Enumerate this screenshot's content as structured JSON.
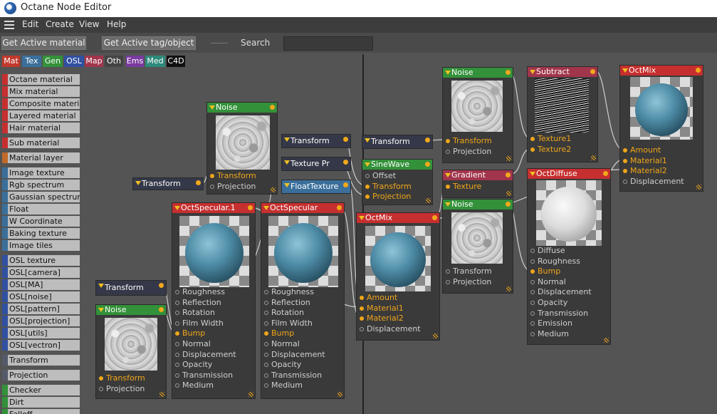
{
  "window": {
    "title": "Octane Node Editor"
  },
  "menu": {
    "items": [
      "Edit",
      "Create",
      "View",
      "Help"
    ]
  },
  "toolbar": {
    "get_active_material": "Get Active material",
    "get_active_tag": "Get Active tag/object",
    "search_label": "Search",
    "search_value": ""
  },
  "categories": [
    {
      "label": "Mat",
      "color": "#c0392b"
    },
    {
      "label": "Tex",
      "color": "#3b6f9b"
    },
    {
      "label": "Gen",
      "color": "#33913a"
    },
    {
      "label": "OSL",
      "color": "#3050a0"
    },
    {
      "label": "Map",
      "color": "#a1354c"
    },
    {
      "label": "Oth",
      "color": "#444444"
    },
    {
      "label": "Ems",
      "color": "#7a3aa0"
    },
    {
      "label": "Med",
      "color": "#2e8a7a"
    },
    {
      "label": "C4D",
      "color": "#111111"
    }
  ],
  "sidebar": {
    "items": [
      {
        "label": "Octane material",
        "color": "#c62f2f"
      },
      {
        "label": "Mix material",
        "color": "#c62f2f"
      },
      {
        "label": "Composite material",
        "color": "#c62f2f"
      },
      {
        "label": "Layered material",
        "color": "#c62f2f"
      },
      {
        "label": "Hair material",
        "color": "#c62f2f"
      },
      {
        "label": "Sub material",
        "color": "#c62f2f"
      },
      {
        "label": "Material layer",
        "color": "#c06a2a"
      },
      {
        "label": "Image texture",
        "color": "#3b6f9b"
      },
      {
        "label": "Rgb spectrum",
        "color": "#3b6f9b"
      },
      {
        "label": "Gaussian spectrum",
        "color": "#3b6f9b"
      },
      {
        "label": "Float",
        "color": "#3b6f9b"
      },
      {
        "label": "W Coordinate",
        "color": "#3b6f9b"
      },
      {
        "label": "Baking texture",
        "color": "#3b6f9b"
      },
      {
        "label": "Image tiles",
        "color": "#3b6f9b"
      },
      {
        "label": "OSL texture",
        "color": "#3050a0"
      },
      {
        "label": "OSL[camera]",
        "color": "#3050a0"
      },
      {
        "label": "OSL[MA]",
        "color": "#3050a0"
      },
      {
        "label": "OSL[noise]",
        "color": "#3050a0"
      },
      {
        "label": "OSL[pattern]",
        "color": "#3050a0"
      },
      {
        "label": "OSL[projection]",
        "color": "#3050a0"
      },
      {
        "label": "OSL[utils]",
        "color": "#3050a0"
      },
      {
        "label": "OSL[vectron]",
        "color": "#3050a0"
      },
      {
        "label": "Transform",
        "color": "#555a6a"
      },
      {
        "label": "Projection",
        "color": "#555a6a"
      },
      {
        "label": "Checker",
        "color": "#33913a"
      },
      {
        "label": "Dirt",
        "color": "#33913a"
      },
      {
        "label": "Falloff",
        "color": "#33913a"
      }
    ]
  },
  "nodes": [
    {
      "title": "Noise",
      "color": "green",
      "preview": "noise",
      "pins": [
        {
          "label": "Transform",
          "active": true
        },
        {
          "label": "Projection",
          "active": false
        }
      ]
    },
    {
      "title": "Transform",
      "color": "dark"
    },
    {
      "title": "OctSpecular.1",
      "color": "red",
      "preview": "specular",
      "pins": [
        {
          "label": "Roughness",
          "active": false
        },
        {
          "label": "Reflection",
          "active": false
        },
        {
          "label": "Rotation",
          "active": false
        },
        {
          "label": "Film Width",
          "active": false
        },
        {
          "label": "Bump",
          "active": true
        },
        {
          "label": "Normal",
          "active": false
        },
        {
          "label": "Displacement",
          "active": false
        },
        {
          "label": "Opacity",
          "active": false
        },
        {
          "label": "Transmission",
          "active": false
        },
        {
          "label": "Medium",
          "active": false
        }
      ]
    },
    {
      "title": "OctSpecular",
      "color": "red",
      "preview": "specular",
      "pins": [
        {
          "label": "Roughness",
          "active": false
        },
        {
          "label": "Reflection",
          "active": false
        },
        {
          "label": "Rotation",
          "active": false
        },
        {
          "label": "Film Width",
          "active": false
        },
        {
          "label": "Bump",
          "active": true
        },
        {
          "label": "Normal",
          "active": false
        },
        {
          "label": "Displacement",
          "active": false
        },
        {
          "label": "Opacity",
          "active": false
        },
        {
          "label": "Transmission",
          "active": false
        },
        {
          "label": "Medium",
          "active": false
        }
      ]
    },
    {
      "title": "Transform",
      "color": "dark"
    },
    {
      "title": "Noise",
      "color": "green",
      "preview": "noise",
      "pins": [
        {
          "label": "Transform",
          "active": true
        },
        {
          "label": "Projection",
          "active": false
        }
      ]
    },
    {
      "title": "Transform",
      "color": "dark"
    },
    {
      "title": "Texture Pr",
      "color": "dark"
    },
    {
      "title": "FloatTexture",
      "color": "blue"
    },
    {
      "title": "Transform",
      "color": "dark"
    },
    {
      "title": "SineWave",
      "color": "green",
      "pins": [
        {
          "label": "Offset",
          "active": false
        },
        {
          "label": "Transform",
          "active": true
        },
        {
          "label": "Projection",
          "active": true
        }
      ]
    },
    {
      "title": "OctMix",
      "color": "red",
      "preview": "specular",
      "pins": [
        {
          "label": "Amount",
          "active": true
        },
        {
          "label": "Material1",
          "active": true
        },
        {
          "label": "Material2",
          "active": true
        },
        {
          "label": "Displacement",
          "active": false
        }
      ]
    },
    {
      "title": "Noise",
      "color": "green",
      "preview": "noise",
      "pins": [
        {
          "label": "Transform",
          "active": true
        },
        {
          "label": "Projection",
          "active": false
        }
      ]
    },
    {
      "title": "Gradient",
      "color": "maroon",
      "pins": [
        {
          "label": "Texture",
          "active": true
        }
      ]
    },
    {
      "title": "Noise",
      "color": "green",
      "preview": "noise",
      "pins": [
        {
          "label": "Transform",
          "active": false
        },
        {
          "label": "Projection",
          "active": false
        }
      ]
    },
    {
      "title": "Subtract",
      "color": "maroon",
      "preview": "stripes",
      "pins": [
        {
          "label": "Texture1",
          "active": true
        },
        {
          "label": "Texture2",
          "active": true
        }
      ]
    },
    {
      "title": "OctDiffuse",
      "color": "red",
      "preview": "diffuse",
      "pins": [
        {
          "label": "Diffuse",
          "active": false
        },
        {
          "label": "Roughness",
          "active": false
        },
        {
          "label": "Bump",
          "active": true
        },
        {
          "label": "Normal",
          "active": false
        },
        {
          "label": "Displacement",
          "active": false
        },
        {
          "label": "Opacity",
          "active": false
        },
        {
          "label": "Transmission",
          "active": false
        },
        {
          "label": "Emission",
          "active": false
        },
        {
          "label": "Medium",
          "active": false
        }
      ]
    },
    {
      "title": "OctMix",
      "color": "red",
      "preview": "specular",
      "pins": [
        {
          "label": "Amount",
          "active": true
        },
        {
          "label": "Material1",
          "active": true
        },
        {
          "label": "Material2",
          "active": true
        },
        {
          "label": "Displacement",
          "active": false
        }
      ]
    }
  ]
}
